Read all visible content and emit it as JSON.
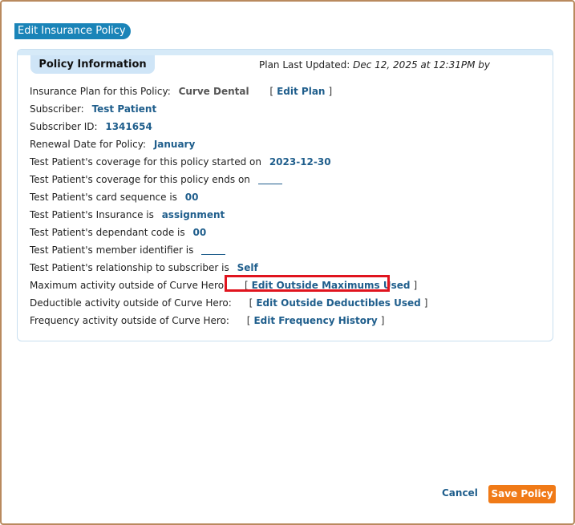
{
  "dialog": {
    "title": "Edit Insurance Policy",
    "section_title": "Policy Information",
    "last_updated_label": "Plan Last Updated:",
    "last_updated_value": "Dec 12, 2025 at 12:31PM by"
  },
  "fields": {
    "plan_label": "Insurance Plan for this Policy:",
    "plan_value": "Curve Dental",
    "edit_plan_link": "Edit Plan",
    "subscriber_label": "Subscriber:",
    "subscriber_value": "Test Patient",
    "subscriber_id_label": "Subscriber ID:",
    "subscriber_id_value": "1341654",
    "renewal_label": "Renewal Date for Policy:",
    "renewal_value": "January",
    "coverage_start_label": "Test Patient's coverage for this policy started on",
    "coverage_start_value": "2023-12-30",
    "coverage_end_label": "Test Patient's coverage for this policy ends on",
    "card_sequence_label": "Test Patient's card sequence is",
    "card_sequence_value": "00",
    "insurance_label": "Test Patient's Insurance is",
    "insurance_value": "assignment",
    "dependant_label": "Test Patient's dependant code is",
    "dependant_value": "00",
    "member_id_label": "Test Patient's member identifier is",
    "relationship_label": "Test Patient's relationship to subscriber is",
    "relationship_value": "Self",
    "max_activity_label": "Maximum activity outside of Curve Hero:",
    "max_activity_link": "Edit Outside Maximums Used",
    "deductible_label": "Deductible activity outside of Curve Hero:",
    "deductible_link": "Edit Outside Deductibles Used",
    "frequency_label": "Frequency activity outside of Curve Hero:",
    "frequency_link": "Edit Frequency History"
  },
  "footer": {
    "cancel_label": "Cancel",
    "save_label": "Save Policy"
  },
  "colors": {
    "title_bg": "#1a84b8",
    "link": "#1f5e8c",
    "save_bg": "#f07a17",
    "highlight": "#e0141e"
  }
}
